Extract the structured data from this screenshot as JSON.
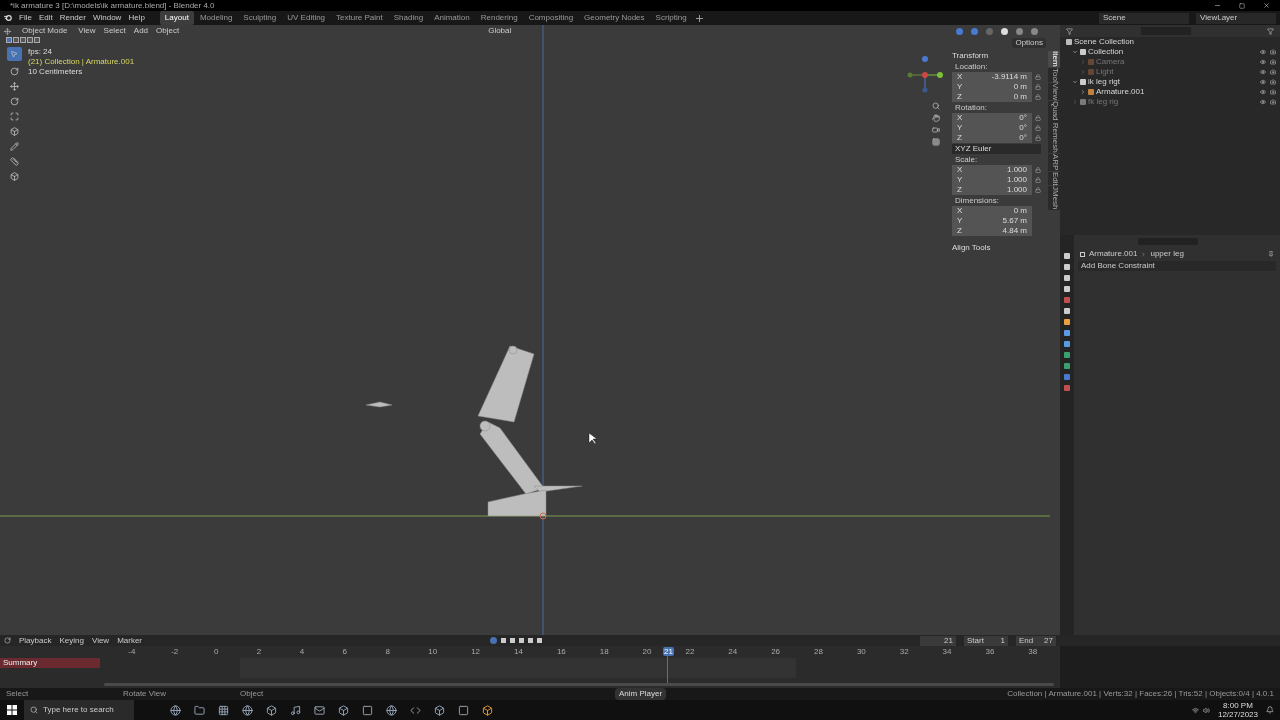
{
  "window": {
    "title": "*ik armature 3 [D:\\models\\ik armature.blend] - Blender 4.0"
  },
  "menu": [
    "File",
    "Edit",
    "Render",
    "Window",
    "Help"
  ],
  "workspaces": [
    {
      "label": "Layout",
      "selected": true
    },
    {
      "label": "Modeling",
      "selected": false
    },
    {
      "label": "Sculpting",
      "selected": false
    },
    {
      "label": "UV Editing",
      "selected": false
    },
    {
      "label": "Texture Paint",
      "selected": false
    },
    {
      "label": "Shading",
      "selected": false
    },
    {
      "label": "Animation",
      "selected": false
    },
    {
      "label": "Rendering",
      "selected": false
    },
    {
      "label": "Compositing",
      "selected": false
    },
    {
      "label": "Geometry Nodes",
      "selected": false
    },
    {
      "label": "Scripting",
      "selected": false
    }
  ],
  "scene": {
    "name": "Scene",
    "view_layer": "ViewLayer"
  },
  "viewport": {
    "mode": "Object Mode",
    "menus": [
      "View",
      "Select",
      "Add",
      "Object"
    ],
    "orientation": "Global",
    "options": "Options",
    "info": [
      "fps: 24",
      "(21) Collection | Armature.001",
      "10 Centimeters"
    ]
  },
  "sidebar_tabs": [
    {
      "label": "Item",
      "selected": true
    },
    {
      "label": "Tool",
      "selected": false
    },
    {
      "label": "View",
      "selected": false
    },
    {
      "label": "Quad Remesh",
      "selected": false
    },
    {
      "label": "ARP",
      "selected": false
    },
    {
      "label": "Edit",
      "selected": false
    },
    {
      "label": "JMesh",
      "selected": false
    }
  ],
  "transform": {
    "title": "Transform",
    "groups": [
      {
        "label": "Location:",
        "fields": [
          {
            "axis": "X",
            "value": "-3.9114 m"
          },
          {
            "axis": "Y",
            "value": "0 m"
          },
          {
            "axis": "Z",
            "value": "0 m"
          }
        ],
        "locks": true
      },
      {
        "label": "Rotation:",
        "fields": [
          {
            "axis": "X",
            "value": "0°"
          },
          {
            "axis": "Y",
            "value": "0°"
          },
          {
            "axis": "Z",
            "value": "0°"
          }
        ],
        "locks": true,
        "mode": "XYZ Euler"
      },
      {
        "label": "Scale:",
        "fields": [
          {
            "axis": "X",
            "value": "1.000"
          },
          {
            "axis": "Y",
            "value": "1.000"
          },
          {
            "axis": "Z",
            "value": "1.000"
          }
        ],
        "locks": true
      },
      {
        "label": "Dimensions:",
        "fields": [
          {
            "axis": "X",
            "value": "0 m"
          },
          {
            "axis": "Y",
            "value": "5.67 m"
          },
          {
            "axis": "Z",
            "value": "4.84 m"
          }
        ],
        "locks": false
      }
    ],
    "align_tools": "Align Tools"
  },
  "outliner": {
    "items": [
      {
        "label": "Scene Collection",
        "kind": "scene",
        "disabled": false,
        "children": [
          {
            "label": "Collection",
            "kind": "collection",
            "expanded": true,
            "disabled": false,
            "children": [
              {
                "label": "Camera",
                "kind": "camera",
                "expanded": false,
                "disabled": true
              },
              {
                "label": "Light",
                "kind": "light",
                "expanded": false,
                "disabled": true
              }
            ]
          },
          {
            "label": "ik leg rigt",
            "kind": "collection",
            "expanded": true,
            "disabled": false,
            "children": [
              {
                "label": "Armature.001",
                "kind": "armature",
                "expanded": false,
                "disabled": false
              }
            ]
          },
          {
            "label": "fk leg rig",
            "kind": "collection",
            "expanded": false,
            "disabled": true
          }
        ]
      }
    ]
  },
  "properties": {
    "breadcrumb": [
      "Armature.001",
      "upper leg"
    ],
    "add_constraint": "Add Bone Constraint"
  },
  "timeline": {
    "menus": [
      "Playback",
      "Keying",
      "View",
      "Marker"
    ],
    "current_frame": "21",
    "start_label": "Start",
    "start": "1",
    "end_label": "End",
    "end": "27",
    "ticks": [
      "-4",
      "-2",
      "0",
      "2",
      "4",
      "6",
      "8",
      "10",
      "12",
      "14",
      "16",
      "18",
      "20",
      "21",
      "22",
      "24",
      "26",
      "28",
      "30",
      "32",
      "34",
      "36",
      "38"
    ],
    "channels": [
      "Summary"
    ]
  },
  "status_bar": {
    "hints": [
      "Select",
      "Rotate View",
      "Object"
    ],
    "center": "Anim Player",
    "stats": "Collection | Armature.001 | Verts:32 | Faces:26 | Tris:52 | Objects:0/4 | 4.0.1"
  },
  "taskbar": {
    "search_placeholder": "Type here to search",
    "time": "8:00 PM",
    "date": "12/27/2023"
  }
}
